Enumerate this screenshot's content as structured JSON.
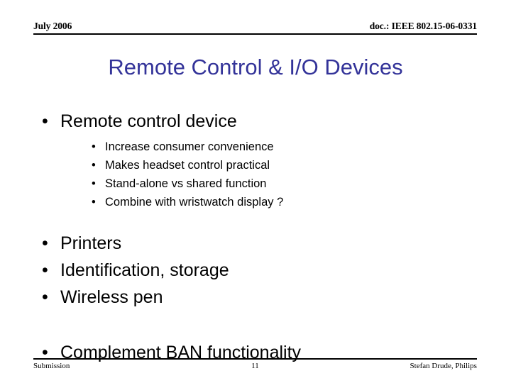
{
  "slide": {
    "header": {
      "date": "July 2006",
      "doc_number": "doc.: IEEE 802.15-06-0331"
    },
    "title": "Remote Control & I/O Devices",
    "title_color": "#333399",
    "bullet_glyph": "•",
    "content": {
      "group1": {
        "level1": "Remote control device",
        "level2": [
          "Increase consumer convenience",
          "Makes headset control practical",
          "Stand-alone vs shared function",
          "Combine with wristwatch display ?"
        ]
      },
      "group2": [
        "Printers",
        "Identification, storage",
        "Wireless pen"
      ],
      "group3": [
        "Complement BAN functionality"
      ]
    },
    "footer": {
      "left": "Submission",
      "page_number": "11",
      "right": "Stefan Drude, Philips"
    }
  }
}
